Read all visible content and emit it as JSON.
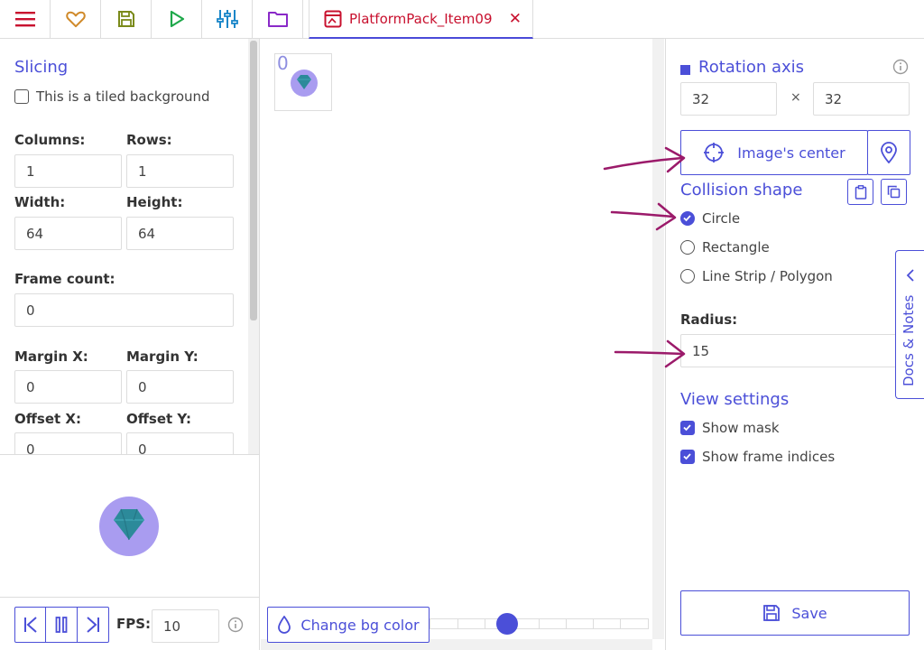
{
  "toolbar": {
    "buttons": [
      "menu-icon",
      "heart-icon",
      "save-icon",
      "play-icon",
      "sliders-icon",
      "folder-icon"
    ],
    "tab_label": "PlatformPack_Item09",
    "tab_close": "✕"
  },
  "left": {
    "section_title": "Slicing",
    "tiled_label": "This is a tiled background",
    "columns_label": "Columns:",
    "rows_label": "Rows:",
    "columns_value": "1",
    "rows_value": "1",
    "width_label": "Width:",
    "height_label": "Height:",
    "width_value": "64",
    "height_value": "64",
    "frame_count_label": "Frame count:",
    "frame_count_value": "0",
    "margin_x_label": "Margin X:",
    "margin_y_label": "Margin Y:",
    "margin_x_value": "0",
    "margin_y_value": "0",
    "offset_x_label": "Offset X:",
    "offset_y_label": "Offset Y:",
    "offset_x_value": "0",
    "offset_y_value": "0",
    "fps_label": "FPS:",
    "fps_value": "10"
  },
  "center": {
    "frame_index": "0",
    "bg_button": "Change bg color",
    "zoom_slider_fraction": 0.34
  },
  "right": {
    "rotation_title": "Rotation axis",
    "axis_x": "32",
    "axis_y": "32",
    "times": "×",
    "center_button": "Image's center",
    "collision_title": "Collision shape",
    "shape_circle": "Circle",
    "shape_rect": "Rectangle",
    "shape_poly": "Line Strip / Polygon",
    "radius_label": "Radius:",
    "radius_value": "15",
    "view_title": "View settings",
    "show_mask": "Show mask",
    "show_indices": "Show frame indices",
    "save_label": "Save",
    "docs_tab": "Docs & Notes"
  },
  "colors": {
    "accent": "#4b4fd8",
    "tab_red": "#c8102e",
    "annotation_arrow": "#9b1a6a",
    "gem_teal": "#2c8a9a",
    "gem_halo": "#a99cf0"
  }
}
